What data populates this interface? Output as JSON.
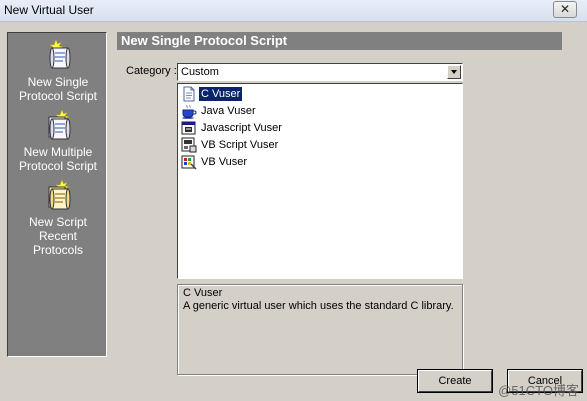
{
  "window": {
    "title": "New Virtual User",
    "close_glyph": "✕"
  },
  "sidebar": {
    "items": [
      {
        "label": "New Single\nProtocol Script",
        "icon": "scroll-icon"
      },
      {
        "label": "New Multiple\nProtocol Script",
        "icon": "scroll-stack-icon"
      },
      {
        "label": "New Script\nRecent\nProtocols",
        "icon": "scroll-recent-icon"
      }
    ]
  },
  "main": {
    "header": "New Single Protocol Script",
    "category_label": "Category :",
    "category_value": "Custom",
    "protocols": [
      {
        "label": "C Vuser",
        "icon": "document-icon",
        "selected": true
      },
      {
        "label": "Java Vuser",
        "icon": "coffee-cup-icon",
        "selected": false
      },
      {
        "label": "Javascript Vuser",
        "icon": "script-window-icon",
        "selected": false
      },
      {
        "label": "VB Script Vuser",
        "icon": "vbscript-icon",
        "selected": false
      },
      {
        "label": "VB Vuser",
        "icon": "vb-icon",
        "selected": false
      }
    ],
    "description_title": "C Vuser",
    "description_text": "A generic virtual user which uses the standard C library."
  },
  "buttons": {
    "create": "Create",
    "cancel": "Cancel"
  },
  "watermark": "@51CTO博客"
}
